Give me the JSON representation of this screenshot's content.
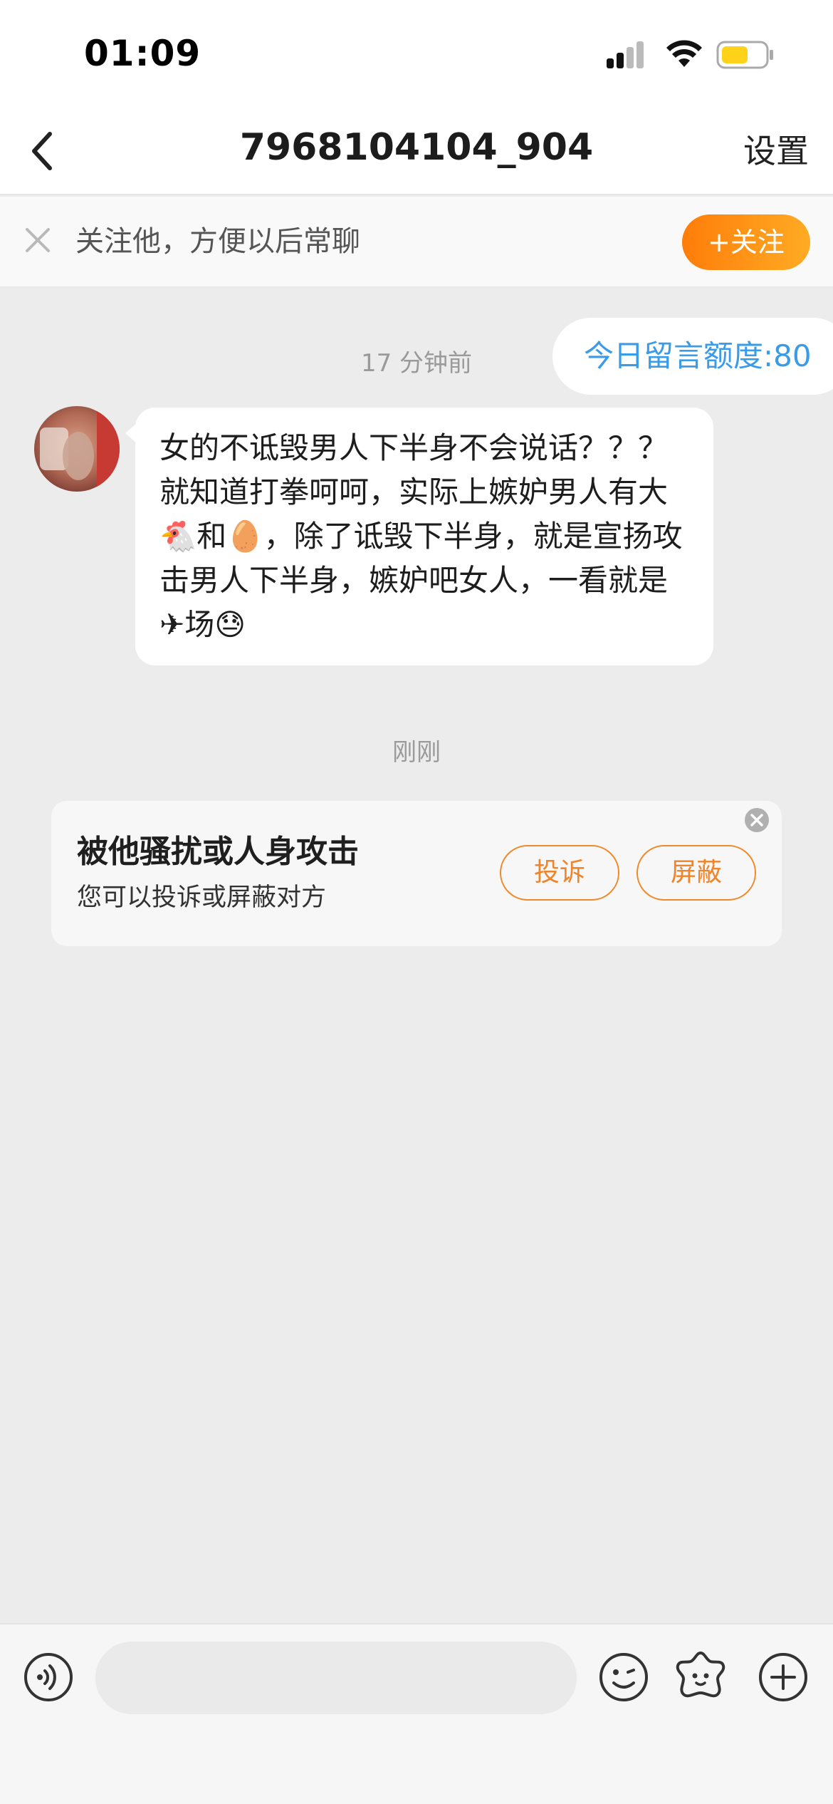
{
  "status_bar": {
    "time": "01:09",
    "signal_icon": "cellular-signal-icon",
    "wifi_icon": "wifi-icon",
    "battery_icon": "battery-low-power-icon",
    "battery_color": "#ffd21a"
  },
  "nav": {
    "title": "7968104104_904",
    "back_icon": "chevron-left-icon",
    "settings_label": "设置"
  },
  "follow_banner": {
    "text": "关注他，方便以后常聊",
    "button_label": "+关注",
    "close_icon": "close-icon"
  },
  "chat": {
    "quota_label": "今日留言额度:80",
    "timestamp_1": "17 分钟前",
    "message_1": "女的不诋毁男人下半身不会说话？？？ 就知道打拳呵呵，实际上嫉妒男人有大🐔和🥚，除了诋毁下半身，就是宣扬攻击男人下半身，嫉妒吧女人，一看就是✈场😓",
    "timestamp_2": "刚刚"
  },
  "report_card": {
    "title": "被他骚扰或人身攻击",
    "subtitle": "您可以投诉或屏蔽对方",
    "report_label": "投诉",
    "block_label": "屏蔽",
    "accent_color": "#f0842a"
  },
  "input_bar": {
    "placeholder": "",
    "voice_icon": "voice-icon",
    "emoji_icon": "emoji-icon",
    "sticker_icon": "sticker-icon",
    "plus_icon": "plus-icon"
  },
  "colors": {
    "background": "#ececec",
    "follow_gradient_start": "#ff7d0a",
    "follow_gradient_end": "#ffab24",
    "quota_text": "#3a9be8"
  }
}
